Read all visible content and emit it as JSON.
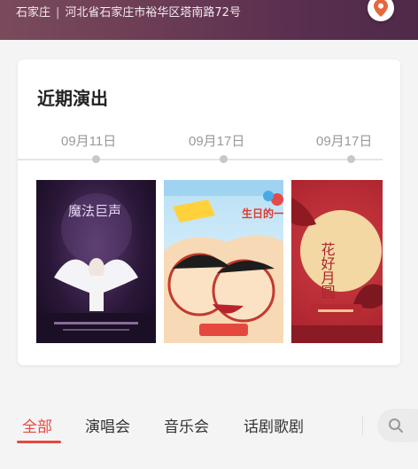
{
  "header": {
    "city": "石家庄",
    "separator": "|",
    "address": "河北省石家庄市裕华区塔南路72号",
    "location_icon": "location-pin-icon",
    "accent": "#e8663c"
  },
  "upcoming": {
    "title": "近期演出",
    "shows": [
      {
        "date": "09月11日",
        "poster_text": "魔法巨声"
      },
      {
        "date": "09月17日",
        "poster_text": "生日的一天"
      },
      {
        "date": "09月17日",
        "poster_text": "花好月圆"
      }
    ]
  },
  "tabs": {
    "items": [
      {
        "label": "全部"
      },
      {
        "label": "演唱会"
      },
      {
        "label": "音乐会"
      },
      {
        "label": "话剧歌剧"
      }
    ],
    "active_color": "#e5483f",
    "search_icon": "search-icon"
  }
}
